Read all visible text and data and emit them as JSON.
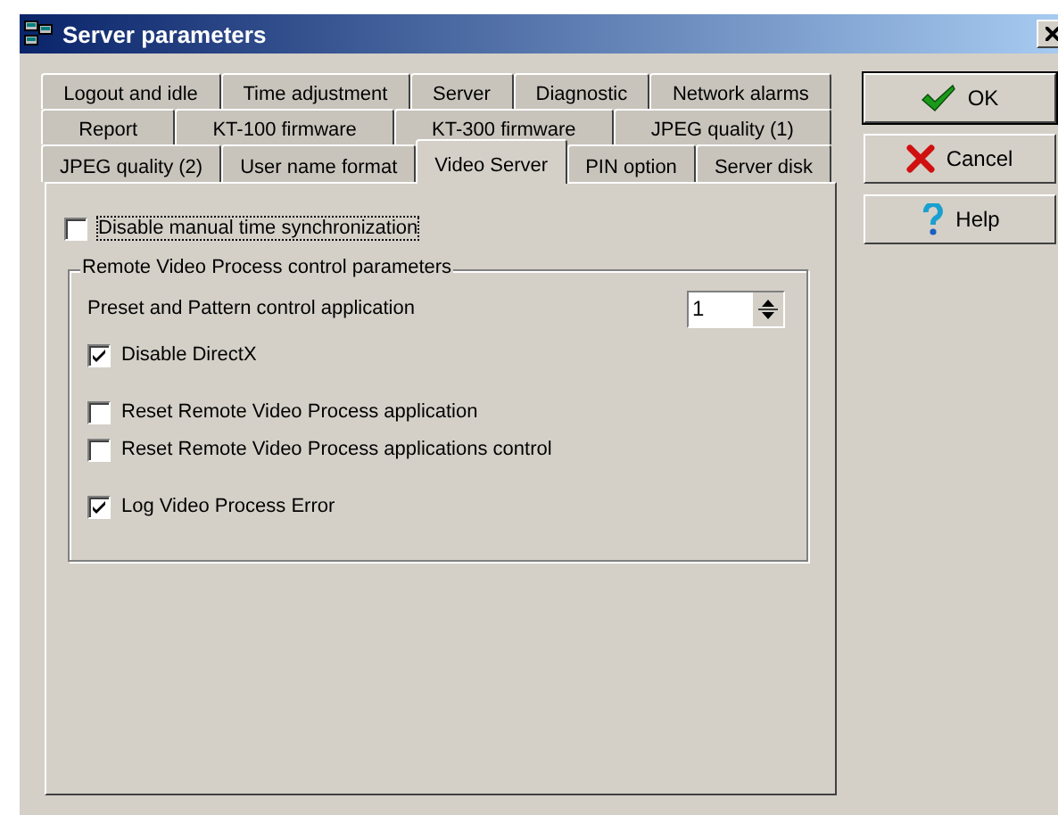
{
  "window": {
    "title": "Server parameters"
  },
  "tab_rows": [
    [
      {
        "label": "Logout and idle",
        "selected": false
      },
      {
        "label": "Time adjustment",
        "selected": false
      },
      {
        "label": "Server",
        "selected": false
      },
      {
        "label": "Diagnostic",
        "selected": false
      },
      {
        "label": "Network alarms",
        "selected": false
      }
    ],
    [
      {
        "label": "Report",
        "selected": false
      },
      {
        "label": "KT-100 firmware",
        "selected": false
      },
      {
        "label": "KT-300 firmware",
        "selected": false
      },
      {
        "label": "JPEG quality (1)",
        "selected": false
      }
    ],
    [
      {
        "label": "JPEG quality (2)",
        "selected": false
      },
      {
        "label": "User name format",
        "selected": false
      },
      {
        "label": "Video Server",
        "selected": true
      },
      {
        "label": "PIN option",
        "selected": false
      },
      {
        "label": "Server disk",
        "selected": false
      }
    ]
  ],
  "top_checkbox": {
    "label": "Disable manual time synchronization",
    "checked": false,
    "focused": true
  },
  "group": {
    "title": "Remote Video Process control parameters",
    "spinner": {
      "label": "Preset and Pattern control application",
      "value": "1"
    },
    "option_groups": [
      [
        {
          "label": "Disable DirectX",
          "checked": true
        }
      ],
      [
        {
          "label": "Reset Remote Video Process application",
          "checked": false
        },
        {
          "label": "Reset Remote Video Process applications control",
          "checked": false
        }
      ],
      [
        {
          "label": "Log Video Process Error",
          "checked": true
        }
      ]
    ]
  },
  "buttons": [
    {
      "label": "OK",
      "kind": "ok",
      "default": true
    },
    {
      "label": "Cancel",
      "kind": "cancel",
      "default": false
    },
    {
      "label": "Help",
      "kind": "help",
      "default": false
    }
  ]
}
